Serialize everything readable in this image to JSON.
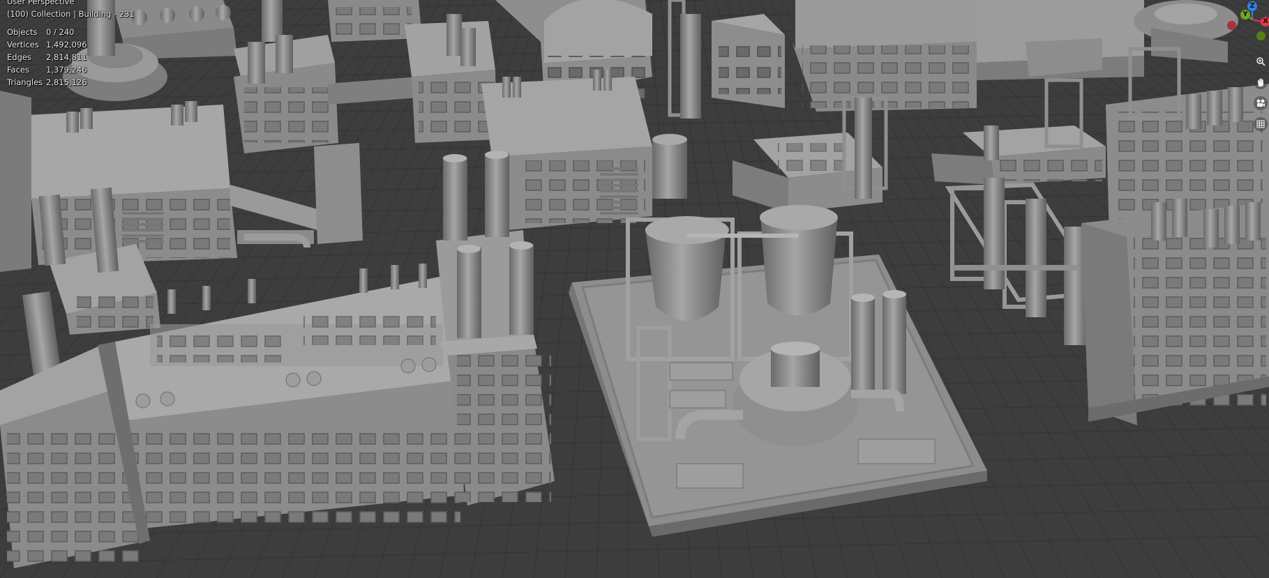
{
  "viewport": {
    "perspective_label": "User Perspective",
    "collection_label": "(100) Collection | Building - 231"
  },
  "stats": [
    {
      "label": "Objects",
      "value": "0 / 240"
    },
    {
      "label": "Vertices",
      "value": "1,492,096"
    },
    {
      "label": "Edges",
      "value": "2,814,811"
    },
    {
      "label": "Faces",
      "value": "1,379,246"
    },
    {
      "label": "Triangles",
      "value": "2,815,126"
    }
  ],
  "gizmo": {
    "z_label": "Z",
    "y_label": "Y",
    "x_label": "X",
    "z_color": "#2f83e6",
    "y_color": "#6ea81f",
    "x_color": "#e0394b"
  },
  "nav_tools": [
    {
      "icon": "zoom-icon"
    },
    {
      "icon": "hand-pan-icon"
    },
    {
      "icon": "camera-icon"
    },
    {
      "icon": "grid-ortho-icon"
    }
  ],
  "colors": {
    "background": "#3d3d3d",
    "grid_line": "#2f2f2f",
    "model_base": "#8e8e8e",
    "model_light": "#a4a4a4",
    "model_dark": "#6b6b6b"
  }
}
